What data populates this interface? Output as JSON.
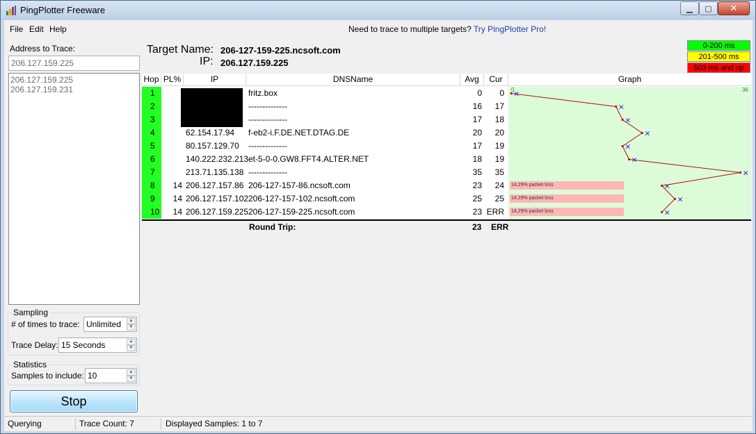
{
  "window": {
    "title": "PingPlotter Freeware"
  },
  "menu": [
    "File",
    "Edit",
    "Help"
  ],
  "promo": {
    "text": "Need to trace to multiple targets?",
    "link": "Try PingPlotter Pro!"
  },
  "address": {
    "label": "Address to Trace:",
    "value": "206.127.159.225",
    "history": [
      "206.127.159.225",
      "206.127.159.231"
    ]
  },
  "sampling": {
    "title": "Sampling",
    "times_label": "# of times to trace:",
    "times_value": "Unlimited",
    "delay_label": "Trace Delay:",
    "delay_value": "15 Seconds"
  },
  "statistics": {
    "title": "Statistics",
    "samples_label": "Samples to include:",
    "samples_value": "10"
  },
  "stop_label": "Stop",
  "target": {
    "name_label": "Target Name:",
    "name_value": "206-127-159-225.ncsoft.com",
    "ip_label": "IP:",
    "ip_value": "206.127.159.225"
  },
  "legend": [
    {
      "label": "0-200 ms",
      "color": "#00ff00"
    },
    {
      "label": "201-500 ms",
      "color": "#ffff00"
    },
    {
      "label": "503 ms and up",
      "color": "#ff0000"
    }
  ],
  "table": {
    "headers": [
      "Hop",
      "PL%",
      "IP",
      "DNSName",
      "Avg",
      "Cur",
      "Graph"
    ],
    "graph_max_label": "36",
    "graph_min_label": "0",
    "rows": [
      {
        "hop": "1",
        "pl": "",
        "ip": "",
        "dns": "fritz.box",
        "avg": "0",
        "cur": "0",
        "loss": ""
      },
      {
        "hop": "2",
        "pl": "",
        "ip": "",
        "dns": "--------------",
        "avg": "16",
        "cur": "17",
        "loss": ""
      },
      {
        "hop": "3",
        "pl": "",
        "ip": "",
        "dns": "--------------",
        "avg": "17",
        "cur": "18",
        "loss": ""
      },
      {
        "hop": "4",
        "pl": "",
        "ip": "62.154.17.94",
        "dns": "f-eb2-i.F.DE.NET.DTAG.DE",
        "avg": "20",
        "cur": "20",
        "loss": ""
      },
      {
        "hop": "5",
        "pl": "",
        "ip": "80.157.129.70",
        "dns": "--------------",
        "avg": "17",
        "cur": "19",
        "loss": ""
      },
      {
        "hop": "6",
        "pl": "",
        "ip": "140.222.232.213",
        "dns": "et-5-0-0.GW8.FFT4.ALTER.NET",
        "avg": "18",
        "cur": "19",
        "loss": ""
      },
      {
        "hop": "7",
        "pl": "",
        "ip": "213.71.135.138",
        "dns": "--------------",
        "avg": "35",
        "cur": "35",
        "loss": ""
      },
      {
        "hop": "8",
        "pl": "14",
        "ip": "206.127.157.86",
        "dns": "206-127-157-86.ncsoft.com",
        "avg": "23",
        "cur": "24",
        "loss": "14,29% packet loss"
      },
      {
        "hop": "9",
        "pl": "14",
        "ip": "206.127.157.102",
        "dns": "206-127-157-102.ncsoft.com",
        "avg": "25",
        "cur": "25",
        "loss": "14,29% packet loss"
      },
      {
        "hop": "10",
        "pl": "14",
        "ip": "206.127.159.225",
        "dns": "206-127-159-225.ncsoft.com",
        "avg": "23",
        "cur": "ERR",
        "loss": "14,29% packet loss"
      }
    ],
    "round_trip": {
      "label": "Round Trip:",
      "avg": "23",
      "cur": "ERR"
    }
  },
  "status": {
    "state": "Querying",
    "trace_count": "Trace Count: 7",
    "displayed": "Displayed Samples: 1 to 7"
  }
}
